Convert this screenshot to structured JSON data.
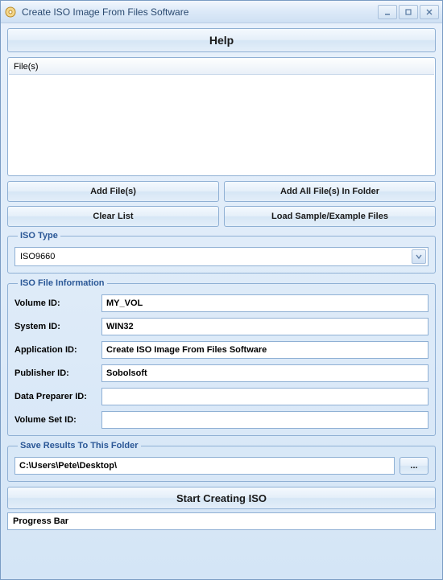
{
  "window": {
    "title": "Create ISO Image From Files Software"
  },
  "help_button": "Help",
  "filelist": {
    "header": "File(s)"
  },
  "buttons": {
    "add_files": "Add File(s)",
    "add_all_in_folder": "Add All File(s) In Folder",
    "clear_list": "Clear List",
    "load_sample": "Load Sample/Example Files",
    "browse": "...",
    "start": "Start Creating ISO"
  },
  "iso_type": {
    "legend": "ISO Type",
    "selected": "ISO9660"
  },
  "iso_info": {
    "legend": "ISO File Information",
    "labels": {
      "volume_id": "Volume ID:",
      "system_id": "System ID:",
      "application_id": "Application ID:",
      "publisher_id": "Publisher ID:",
      "data_preparer_id": "Data Preparer ID:",
      "volume_set_id": "Volume Set ID:"
    },
    "values": {
      "volume_id": "MY_VOL",
      "system_id": "WIN32",
      "application_id": "Create ISO Image From Files Software",
      "publisher_id": "Sobolsoft",
      "data_preparer_id": "",
      "volume_set_id": ""
    }
  },
  "save_folder": {
    "legend": "Save Results To This Folder",
    "path": "C:\\Users\\Pete\\Desktop\\"
  },
  "progress": {
    "label": "Progress Bar"
  }
}
